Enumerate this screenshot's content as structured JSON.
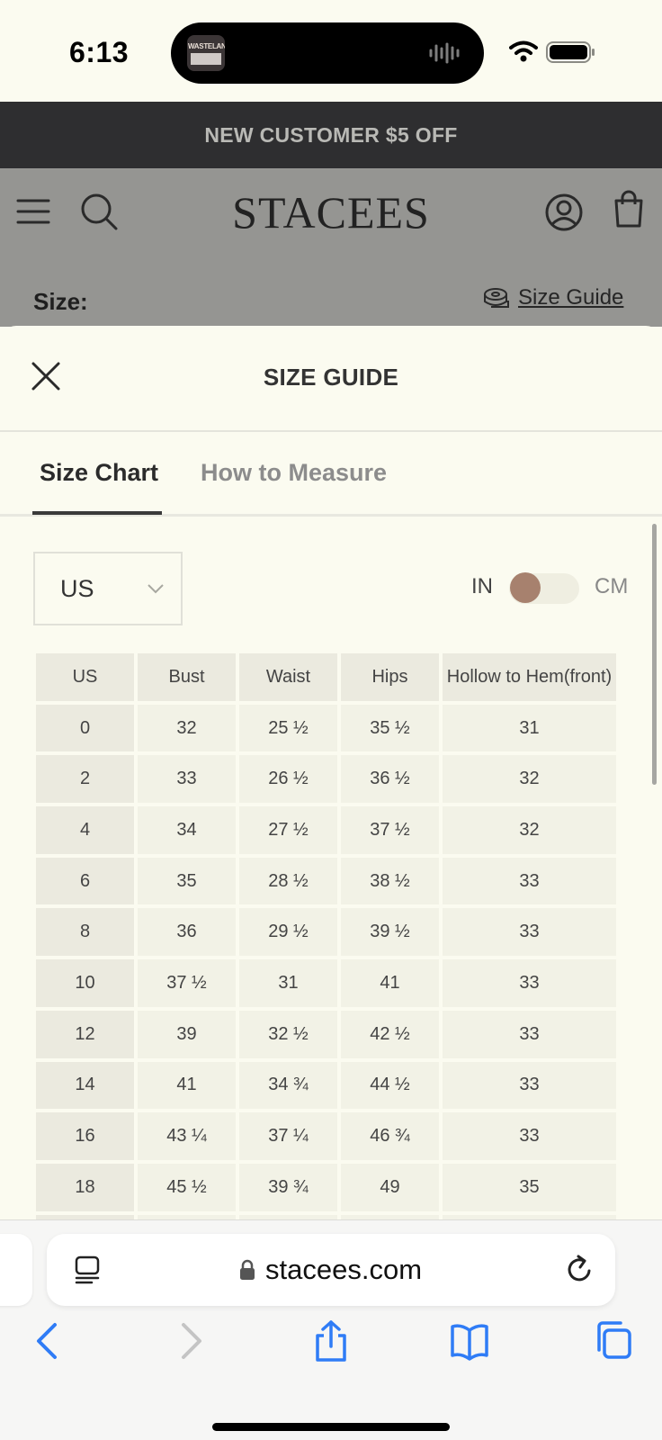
{
  "status_bar": {
    "time": "6:13",
    "now_playing_art_text": "WASTELAND"
  },
  "promo": {
    "text": "NEW CUSTOMER $5 OFF"
  },
  "header": {
    "logo": "STACEES"
  },
  "product": {
    "size_label": "Size:",
    "size_guide_link": "Size Guide"
  },
  "size_guide": {
    "title": "SIZE GUIDE",
    "tabs": [
      {
        "label": "Size Chart",
        "active": true
      },
      {
        "label": "How to Measure",
        "active": false
      }
    ],
    "region_select": {
      "value": "US"
    },
    "unit_toggle": {
      "left_label": "IN",
      "right_label": "CM",
      "selected": "IN"
    },
    "table": {
      "headers": [
        "US",
        "Bust",
        "Waist",
        "Hips",
        "Hollow to Hem(front)"
      ],
      "rows": [
        [
          "0",
          "32",
          "25 ½",
          "35 ½",
          "31"
        ],
        [
          "2",
          "33",
          "26 ½",
          "36 ½",
          "32"
        ],
        [
          "4",
          "34",
          "27 ½",
          "37 ½",
          "32"
        ],
        [
          "6",
          "35",
          "28 ½",
          "38 ½",
          "33"
        ],
        [
          "8",
          "36",
          "29 ½",
          "39 ½",
          "33"
        ],
        [
          "10",
          "37 ½",
          "31",
          "41",
          "33"
        ],
        [
          "12",
          "39",
          "32 ½",
          "42 ½",
          "33"
        ],
        [
          "14",
          "41",
          "34 ¾",
          "44 ½",
          "33"
        ],
        [
          "16",
          "43 ¼",
          "37 ¼",
          "46 ¾",
          "33"
        ],
        [
          "18",
          "45 ½",
          "39 ¾",
          "49",
          "35"
        ]
      ]
    }
  },
  "browser": {
    "url": "stacees.com"
  },
  "colors": {
    "page_bg": "#fbfbf0",
    "promo_bg": "#2e2e30",
    "overlay_header_bg": "#959592",
    "toggle_knob": "#a7816e",
    "ios_blue": "#2f7cf6"
  }
}
